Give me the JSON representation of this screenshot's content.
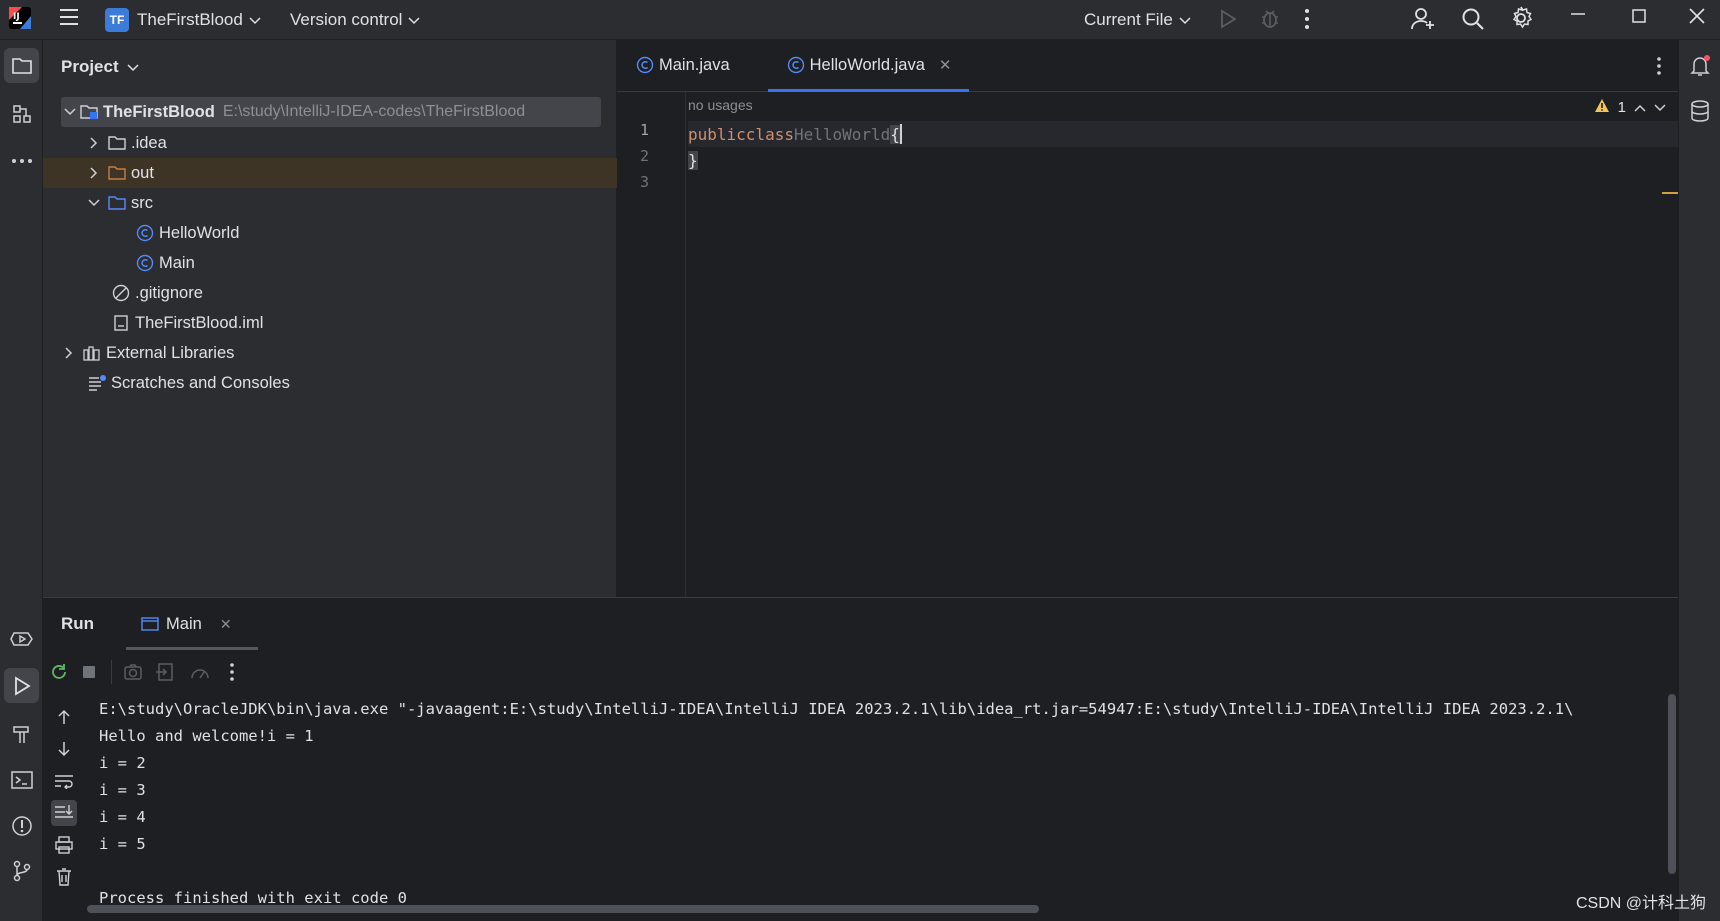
{
  "titlebar": {
    "project_badge": "TF",
    "project_name": "TheFirstBlood",
    "vcs_label": "Version control",
    "run_config": "Current File"
  },
  "project_panel": {
    "title": "Project",
    "root": {
      "name": "TheFirstBlood",
      "path": "E:\\study\\IntelliJ-IDEA-codes\\TheFirstBlood"
    },
    "items": [
      {
        "label": ".idea"
      },
      {
        "label": "out"
      },
      {
        "label": "src"
      },
      {
        "label": "HelloWorld"
      },
      {
        "label": "Main"
      },
      {
        "label": ".gitignore"
      },
      {
        "label": "TheFirstBlood.iml"
      },
      {
        "label": "External Libraries"
      },
      {
        "label": "Scratches and Consoles"
      }
    ]
  },
  "editor": {
    "tabs": [
      {
        "label": "Main.java"
      },
      {
        "label": "HelloWorld.java"
      }
    ],
    "usage_hint": "no usages",
    "warning_count": "1",
    "line_numbers": [
      "1",
      "2",
      "3"
    ],
    "code": {
      "kw1": "public",
      "kw2": "class",
      "class_name": "HelloWorld",
      "open_brace": "{",
      "close_brace": "}"
    }
  },
  "run_panel": {
    "title": "Run",
    "tab": "Main",
    "console_lines": [
      "E:\\study\\OracleJDK\\bin\\java.exe \"-javaagent:E:\\study\\IntelliJ-IDEA\\IntelliJ IDEA 2023.2.1\\lib\\idea_rt.jar=54947:E:\\study\\IntelliJ-IDEA\\IntelliJ IDEA 2023.2.1\\",
      "Hello and welcome!i = 1",
      "i = 2",
      "i = 3",
      "i = 4",
      "i = 5",
      "",
      "Process finished with exit code 0"
    ]
  },
  "watermark": "CSDN @计科土狗",
  "colors": {
    "accent": "#3574f0",
    "keyword": "#cf8e6d",
    "folder_out": "#c57d47",
    "class_icon": "#548af7",
    "warning": "#f2c55c"
  }
}
